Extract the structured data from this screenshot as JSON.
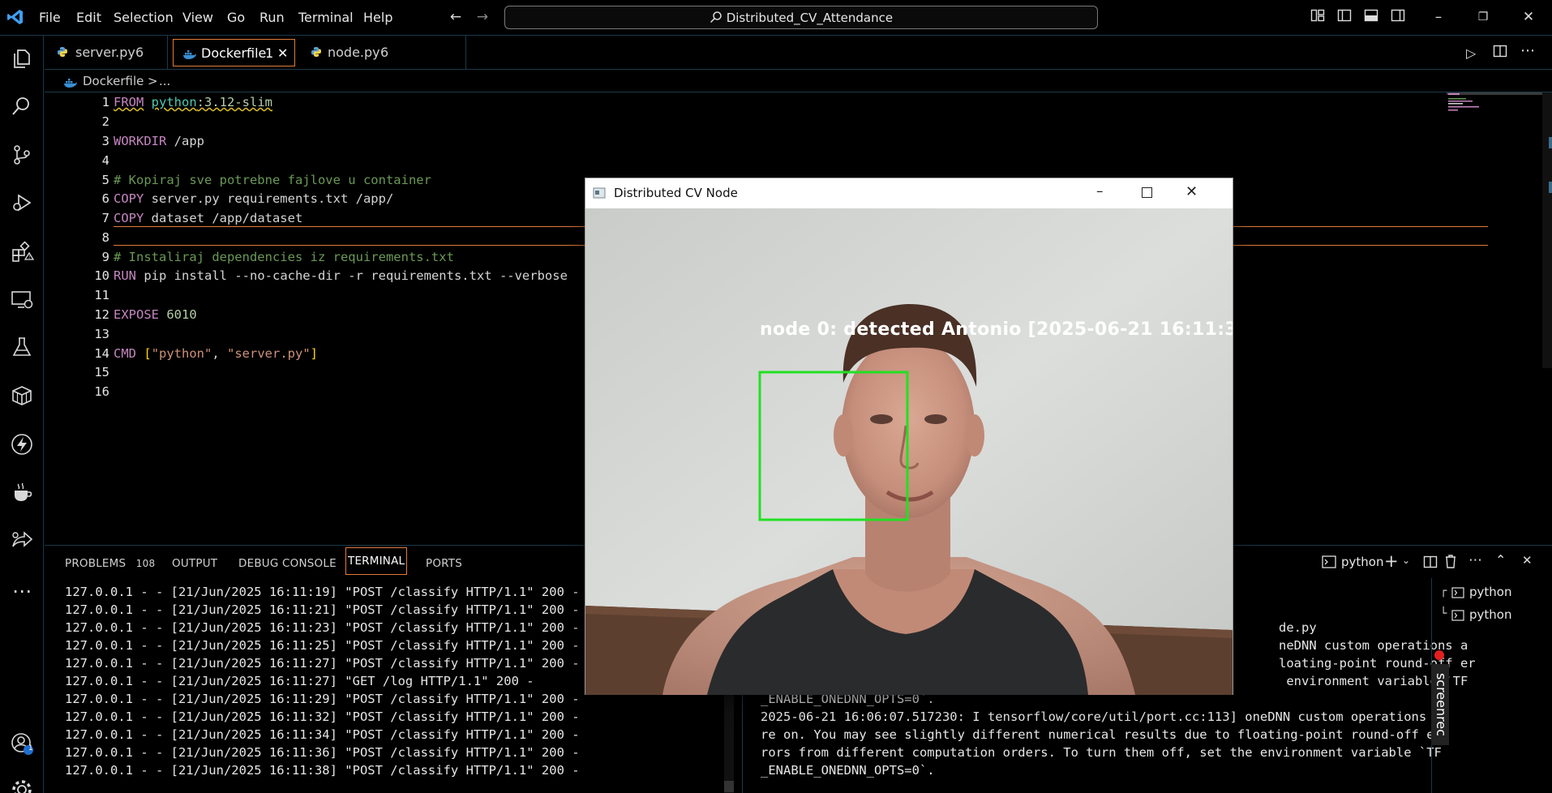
{
  "titlebar": {
    "menu": [
      "File",
      "Edit",
      "Selection",
      "View",
      "Go",
      "Run",
      "Terminal",
      "Help"
    ],
    "search_text": "Distributed_CV_Attendance"
  },
  "tabs": [
    {
      "label": "server.py",
      "badge": "6",
      "icon": "python-icon"
    },
    {
      "label": "Dockerfile",
      "badge": "1",
      "icon": "docker-icon",
      "active": true
    },
    {
      "label": "node.py",
      "badge": "6",
      "icon": "python-icon"
    }
  ],
  "breadcrumb": {
    "file": "Dockerfile",
    "sep": ">",
    "more": "..."
  },
  "editor": {
    "line_numbers": [
      "1",
      "2",
      "3",
      "4",
      "5",
      "6",
      "7",
      "8",
      "9",
      "10",
      "11",
      "12",
      "13",
      "14",
      "15",
      "16"
    ],
    "lines": {
      "l1_kw": "FROM",
      "l1_img": "python",
      "l1_tag": ":3.12-slim",
      "l3_kw": "WORKDIR",
      "l3_arg": "/app",
      "l5": "# Kopiraj sve potrebne fajlove u container",
      "l6_kw": "COPY",
      "l6_arg": "server.py requirements.txt /app/",
      "l7_kw": "COPY",
      "l7_arg": "dataset /app/dataset",
      "l9": "# Instaliraj dependencies iz requirements.txt",
      "l10_kw": "RUN",
      "l10_arg": "pip install --no-cache-dir -r requirements.txt --verbose",
      "l12_kw": "EXPOSE",
      "l12_arg": "6010",
      "l14_kw": "CMD",
      "l14_open": "[",
      "l14_a": "\"python\"",
      "l14_comma": ", ",
      "l14_b": "\"server.py\"",
      "l14_close": "]"
    }
  },
  "panel": {
    "tabs": {
      "problems": "PROBLEMS",
      "problems_count": "108",
      "output": "OUTPUT",
      "debug": "DEBUG CONSOLE",
      "terminal": "TERMINAL",
      "ports": "PORTS"
    },
    "terminal_profile": "python",
    "terminal_list": [
      "python",
      "python"
    ],
    "left_terminal": [
      "127.0.0.1 - - [21/Jun/2025 16:11:19] \"POST /classify HTTP/1.1\" 200 -",
      "127.0.0.1 - - [21/Jun/2025 16:11:21] \"POST /classify HTTP/1.1\" 200 -",
      "127.0.0.1 - - [21/Jun/2025 16:11:23] \"POST /classify HTTP/1.1\" 200 -",
      "127.0.0.1 - - [21/Jun/2025 16:11:25] \"POST /classify HTTP/1.1\" 200 -",
      "127.0.0.1 - - [21/Jun/2025 16:11:27] \"POST /classify HTTP/1.1\" 200 -",
      "127.0.0.1 - - [21/Jun/2025 16:11:27] \"GET /log HTTP/1.1\" 200 -",
      "127.0.0.1 - - [21/Jun/2025 16:11:29] \"POST /classify HTTP/1.1\" 200 -",
      "127.0.0.1 - - [21/Jun/2025 16:11:32] \"POST /classify HTTP/1.1\" 200 -",
      "127.0.0.1 - - [21/Jun/2025 16:11:34] \"POST /classify HTTP/1.1\" 200 -",
      "127.0.0.1 - - [21/Jun/2025 16:11:36] \"POST /classify HTTP/1.1\" 200 -",
      "127.0.0.1 - - [21/Jun/2025 16:11:38] \"POST /classify HTTP/1.1\" 200 -"
    ],
    "right_terminal_partial": [
      "de.py",
      "neDNN custom operations a",
      "loating-point round-off er",
      " environment variable `TF"
    ],
    "right_terminal": [
      "_ENABLE_ONEDNN_OPTS=0`.",
      "2025-06-21 16:06:07.517230: I tensorflow/core/util/port.cc:113] oneDNN custom operations a",
      "re on. You may see slightly different numerical results due to floating-point round-off er",
      "rors from different computation orders. To turn them off, set the environment variable `TF",
      "_ENABLE_ONEDNN_OPTS=0`."
    ]
  },
  "cv_window": {
    "title": "Distributed CV Node",
    "overlay_text": "node 0: detected Antonio [2025-06-21 16:11:3"
  },
  "screenrec": {
    "label": "screenrec"
  },
  "activity": {
    "accounts_badge": "1"
  }
}
